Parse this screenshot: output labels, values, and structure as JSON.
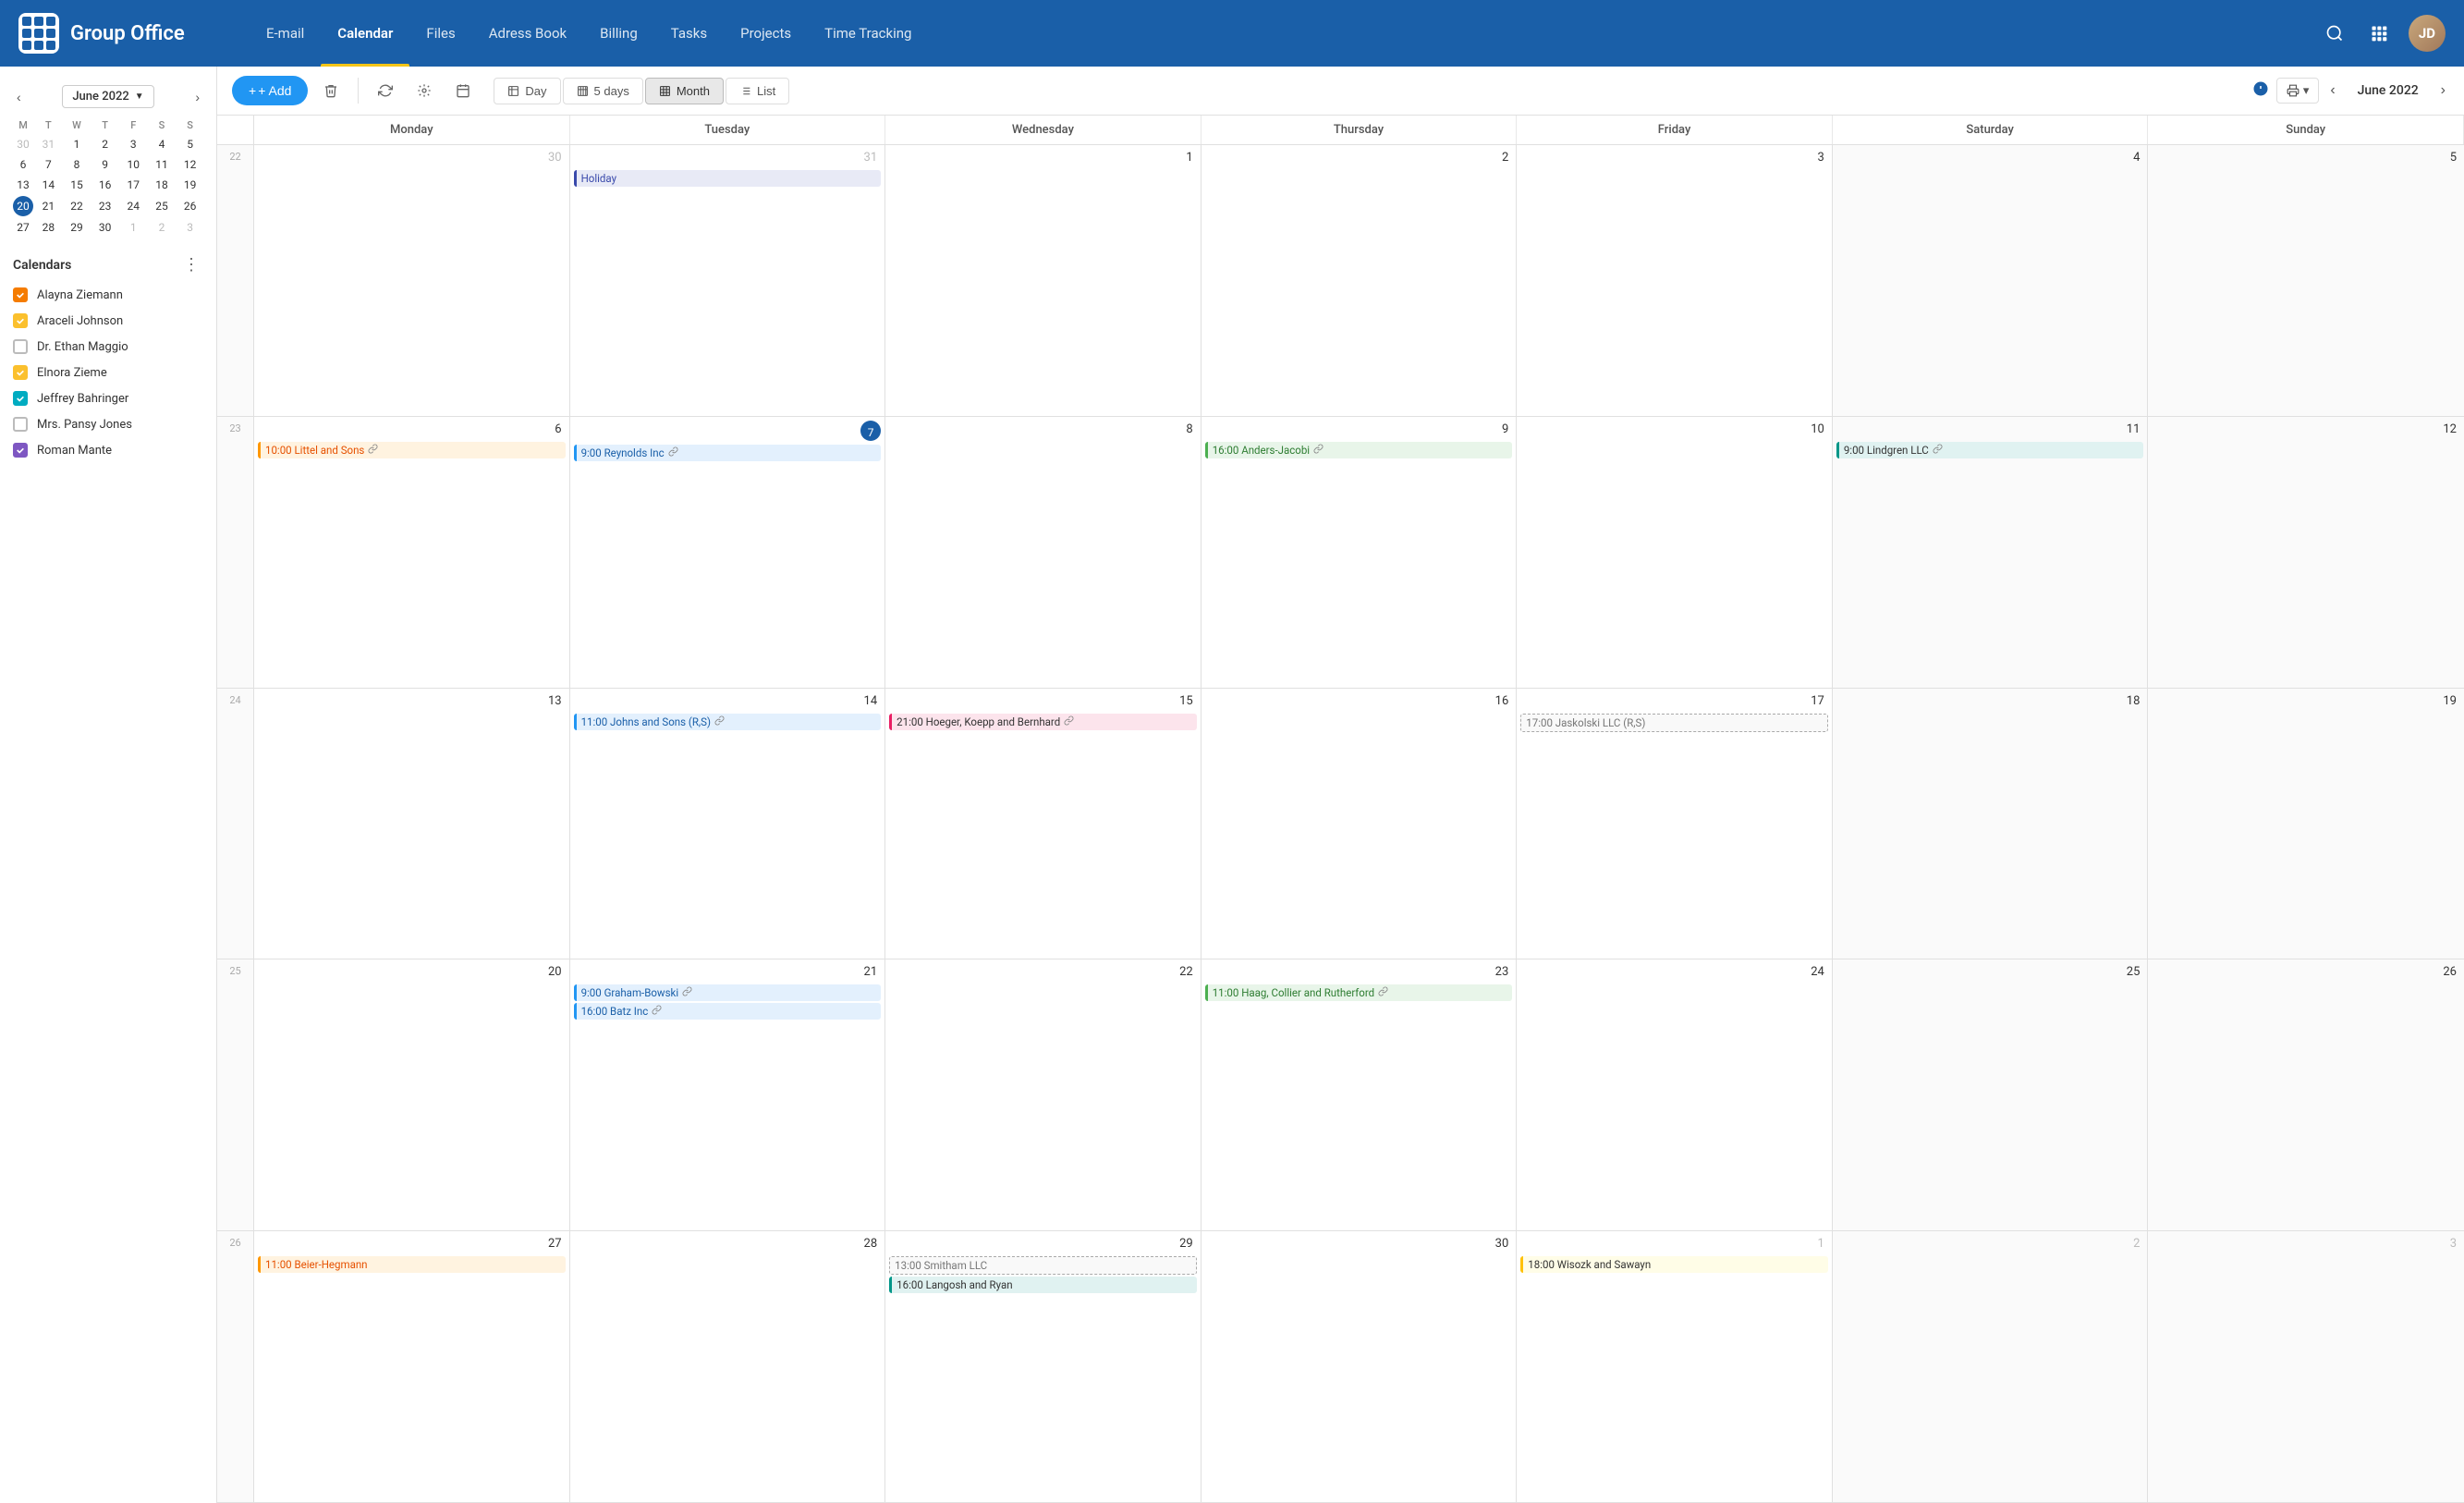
{
  "app": {
    "logo_text": "Group Office",
    "nav_items": [
      "E-mail",
      "Calendar",
      "Files",
      "Adress Book",
      "Billing",
      "Tasks",
      "Projects",
      "Time Tracking"
    ],
    "active_nav": "Calendar"
  },
  "header": {
    "month_label": "June 2022",
    "add_label": "+ Add"
  },
  "view_buttons": [
    {
      "label": "Day",
      "icon": "▦",
      "id": "day"
    },
    {
      "label": "5 days",
      "icon": "⊞",
      "id": "5days"
    },
    {
      "label": "Month",
      "icon": "⊟",
      "id": "month",
      "active": true
    },
    {
      "label": "List",
      "icon": "☰",
      "id": "list"
    }
  ],
  "mini_cal": {
    "month": "June 2022",
    "weekdays": [
      "M",
      "T",
      "W",
      "T",
      "F",
      "S",
      "S"
    ],
    "weeks": [
      [
        {
          "d": "30",
          "om": true
        },
        {
          "d": "31",
          "om": true
        },
        {
          "d": "1"
        },
        {
          "d": "2"
        },
        {
          "d": "3"
        },
        {
          "d": "4"
        },
        {
          "d": "5"
        }
      ],
      [
        {
          "d": "6"
        },
        {
          "d": "7"
        },
        {
          "d": "8"
        },
        {
          "d": "9"
        },
        {
          "d": "10"
        },
        {
          "d": "11"
        },
        {
          "d": "12"
        }
      ],
      [
        {
          "d": "13"
        },
        {
          "d": "14"
        },
        {
          "d": "15"
        },
        {
          "d": "16"
        },
        {
          "d": "17"
        },
        {
          "d": "18"
        },
        {
          "d": "19"
        }
      ],
      [
        {
          "d": "20",
          "today": true
        },
        {
          "d": "21"
        },
        {
          "d": "22"
        },
        {
          "d": "23"
        },
        {
          "d": "24"
        },
        {
          "d": "25"
        },
        {
          "d": "26"
        }
      ],
      [
        {
          "d": "27"
        },
        {
          "d": "28"
        },
        {
          "d": "29"
        },
        {
          "d": "30"
        },
        {
          "d": "1",
          "om": true
        },
        {
          "d": "2",
          "om": true
        },
        {
          "d": "3",
          "om": true
        }
      ]
    ]
  },
  "calendars": {
    "title": "Calendars",
    "items": [
      {
        "name": "Alayna Ziemann",
        "color": "#f57c00",
        "checked": true
      },
      {
        "name": "Araceli Johnson",
        "color": "#fbc02d",
        "checked": true
      },
      {
        "name": "Dr. Ethan Maggio",
        "color": "#9e9e9e",
        "checked": false
      },
      {
        "name": "Elnora Zieme",
        "color": "#fbc02d",
        "checked": true
      },
      {
        "name": "Jeffrey Bahringer",
        "color": "#00acc1",
        "checked": true
      },
      {
        "name": "Mrs. Pansy Jones",
        "color": "#9e9e9e",
        "checked": false
      },
      {
        "name": "Roman Mante",
        "color": "#7e57c2",
        "checked": true
      }
    ]
  },
  "calendar": {
    "current_month": "June 2022",
    "header_days": [
      "Monday",
      "Tuesday",
      "Wednesday",
      "Thursday",
      "Friday",
      "Saturday",
      "Sunday"
    ],
    "weeks": [
      {
        "week_num": "22",
        "days": [
          {
            "d": "30",
            "om": true,
            "events": []
          },
          {
            "d": "31",
            "om": true,
            "events": [
              {
                "label": "Holiday",
                "type": "holiday"
              }
            ]
          },
          {
            "d": "1",
            "events": []
          },
          {
            "d": "2",
            "events": []
          },
          {
            "d": "3",
            "events": []
          },
          {
            "d": "4",
            "om": false,
            "events": [],
            "weekend": true
          },
          {
            "d": "5",
            "om": false,
            "events": [],
            "weekend": true
          }
        ]
      },
      {
        "week_num": "23",
        "days": [
          {
            "d": "6",
            "events": [
              {
                "label": "10:00 Littel and Sons",
                "type": "orange",
                "link": true
              }
            ]
          },
          {
            "d": "7",
            "today": true,
            "events": [
              {
                "label": "9:00 Reynolds Inc",
                "type": "blue",
                "link": true
              }
            ]
          },
          {
            "d": "8",
            "events": []
          },
          {
            "d": "9",
            "events": [
              {
                "label": "16:00 Anders-Jacobi",
                "type": "green",
                "link": true
              }
            ]
          },
          {
            "d": "10",
            "events": []
          },
          {
            "d": "11",
            "events": [
              {
                "label": "9:00 Lindgren LLC",
                "type": "teal",
                "link": true
              }
            ],
            "weekend": true
          },
          {
            "d": "12",
            "events": [],
            "weekend": true
          }
        ]
      },
      {
        "week_num": "24",
        "days": [
          {
            "d": "13",
            "events": []
          },
          {
            "d": "14",
            "events": [
              {
                "label": "11:00 Johns and Sons (R,S)",
                "type": "blue",
                "link": true
              }
            ]
          },
          {
            "d": "15",
            "events": [
              {
                "label": "21:00 Hoeger, Koepp and Bernhard",
                "type": "pink",
                "link": true
              }
            ]
          },
          {
            "d": "16",
            "events": []
          },
          {
            "d": "17",
            "events": [
              {
                "label": "17:00 Jaskolski LLC (R,S)",
                "type": "dashed"
              }
            ]
          },
          {
            "d": "18",
            "events": [],
            "weekend": true
          },
          {
            "d": "19",
            "events": [],
            "weekend": true
          }
        ]
      },
      {
        "week_num": "25",
        "days": [
          {
            "d": "20",
            "events": []
          },
          {
            "d": "21",
            "events": [
              {
                "label": "9:00 Graham-Bowski",
                "type": "blue",
                "link": true
              },
              {
                "label": "16:00 Batz Inc",
                "type": "blue",
                "link": true
              }
            ]
          },
          {
            "d": "22",
            "events": []
          },
          {
            "d": "23",
            "events": [
              {
                "label": "11:00 Haag, Collier and Rutherford",
                "type": "green",
                "link": true
              }
            ]
          },
          {
            "d": "24",
            "events": []
          },
          {
            "d": "25",
            "events": [],
            "weekend": true
          },
          {
            "d": "26",
            "events": [],
            "weekend": true
          }
        ]
      },
      {
        "week_num": "26",
        "days": [
          {
            "d": "27",
            "events": [
              {
                "label": "11:00 Beier-Hegmann",
                "type": "orange"
              }
            ]
          },
          {
            "d": "28",
            "events": []
          },
          {
            "d": "29",
            "events": [
              {
                "label": "13:00 Smitham LLC",
                "type": "dashed"
              },
              {
                "label": "16:00 Langosh and Ryan",
                "type": "teal"
              }
            ]
          },
          {
            "d": "30",
            "events": []
          },
          {
            "d": "1",
            "om": true,
            "events": [
              {
                "label": "18:00 Wisozk and Sawayn",
                "type": "yellow"
              }
            ]
          },
          {
            "d": "2",
            "om": true,
            "events": [],
            "weekend": true
          },
          {
            "d": "3",
            "om": true,
            "events": [],
            "weekend": true
          }
        ]
      }
    ]
  }
}
